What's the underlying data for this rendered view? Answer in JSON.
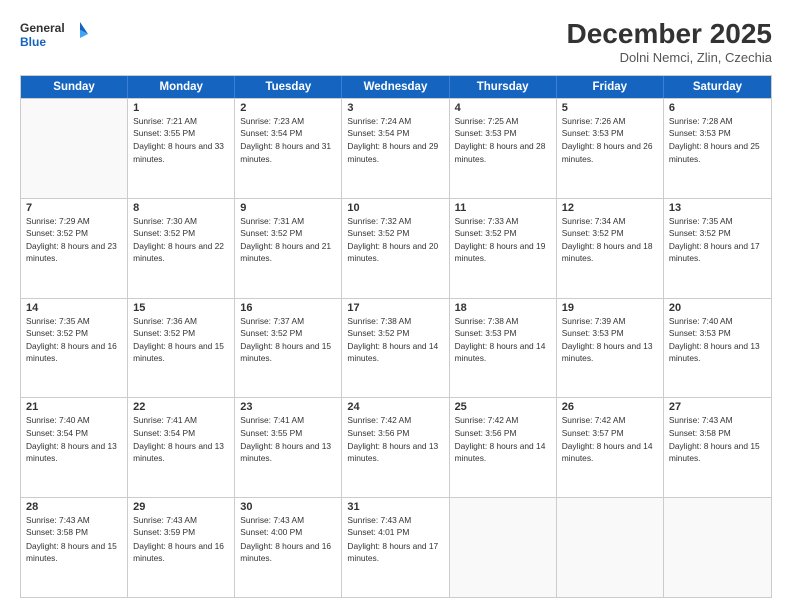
{
  "header": {
    "logo_line1": "General",
    "logo_line2": "Blue",
    "month": "December 2025",
    "location": "Dolni Nemci, Zlin, Czechia"
  },
  "days_of_week": [
    "Sunday",
    "Monday",
    "Tuesday",
    "Wednesday",
    "Thursday",
    "Friday",
    "Saturday"
  ],
  "weeks": [
    [
      {
        "day": "",
        "sunrise": "",
        "sunset": "",
        "daylight": ""
      },
      {
        "day": "1",
        "sunrise": "Sunrise: 7:21 AM",
        "sunset": "Sunset: 3:55 PM",
        "daylight": "Daylight: 8 hours and 33 minutes."
      },
      {
        "day": "2",
        "sunrise": "Sunrise: 7:23 AM",
        "sunset": "Sunset: 3:54 PM",
        "daylight": "Daylight: 8 hours and 31 minutes."
      },
      {
        "day": "3",
        "sunrise": "Sunrise: 7:24 AM",
        "sunset": "Sunset: 3:54 PM",
        "daylight": "Daylight: 8 hours and 29 minutes."
      },
      {
        "day": "4",
        "sunrise": "Sunrise: 7:25 AM",
        "sunset": "Sunset: 3:53 PM",
        "daylight": "Daylight: 8 hours and 28 minutes."
      },
      {
        "day": "5",
        "sunrise": "Sunrise: 7:26 AM",
        "sunset": "Sunset: 3:53 PM",
        "daylight": "Daylight: 8 hours and 26 minutes."
      },
      {
        "day": "6",
        "sunrise": "Sunrise: 7:28 AM",
        "sunset": "Sunset: 3:53 PM",
        "daylight": "Daylight: 8 hours and 25 minutes."
      }
    ],
    [
      {
        "day": "7",
        "sunrise": "Sunrise: 7:29 AM",
        "sunset": "Sunset: 3:52 PM",
        "daylight": "Daylight: 8 hours and 23 minutes."
      },
      {
        "day": "8",
        "sunrise": "Sunrise: 7:30 AM",
        "sunset": "Sunset: 3:52 PM",
        "daylight": "Daylight: 8 hours and 22 minutes."
      },
      {
        "day": "9",
        "sunrise": "Sunrise: 7:31 AM",
        "sunset": "Sunset: 3:52 PM",
        "daylight": "Daylight: 8 hours and 21 minutes."
      },
      {
        "day": "10",
        "sunrise": "Sunrise: 7:32 AM",
        "sunset": "Sunset: 3:52 PM",
        "daylight": "Daylight: 8 hours and 20 minutes."
      },
      {
        "day": "11",
        "sunrise": "Sunrise: 7:33 AM",
        "sunset": "Sunset: 3:52 PM",
        "daylight": "Daylight: 8 hours and 19 minutes."
      },
      {
        "day": "12",
        "sunrise": "Sunrise: 7:34 AM",
        "sunset": "Sunset: 3:52 PM",
        "daylight": "Daylight: 8 hours and 18 minutes."
      },
      {
        "day": "13",
        "sunrise": "Sunrise: 7:35 AM",
        "sunset": "Sunset: 3:52 PM",
        "daylight": "Daylight: 8 hours and 17 minutes."
      }
    ],
    [
      {
        "day": "14",
        "sunrise": "Sunrise: 7:35 AM",
        "sunset": "Sunset: 3:52 PM",
        "daylight": "Daylight: 8 hours and 16 minutes."
      },
      {
        "day": "15",
        "sunrise": "Sunrise: 7:36 AM",
        "sunset": "Sunset: 3:52 PM",
        "daylight": "Daylight: 8 hours and 15 minutes."
      },
      {
        "day": "16",
        "sunrise": "Sunrise: 7:37 AM",
        "sunset": "Sunset: 3:52 PM",
        "daylight": "Daylight: 8 hours and 15 minutes."
      },
      {
        "day": "17",
        "sunrise": "Sunrise: 7:38 AM",
        "sunset": "Sunset: 3:52 PM",
        "daylight": "Daylight: 8 hours and 14 minutes."
      },
      {
        "day": "18",
        "sunrise": "Sunrise: 7:38 AM",
        "sunset": "Sunset: 3:53 PM",
        "daylight": "Daylight: 8 hours and 14 minutes."
      },
      {
        "day": "19",
        "sunrise": "Sunrise: 7:39 AM",
        "sunset": "Sunset: 3:53 PM",
        "daylight": "Daylight: 8 hours and 13 minutes."
      },
      {
        "day": "20",
        "sunrise": "Sunrise: 7:40 AM",
        "sunset": "Sunset: 3:53 PM",
        "daylight": "Daylight: 8 hours and 13 minutes."
      }
    ],
    [
      {
        "day": "21",
        "sunrise": "Sunrise: 7:40 AM",
        "sunset": "Sunset: 3:54 PM",
        "daylight": "Daylight: 8 hours and 13 minutes."
      },
      {
        "day": "22",
        "sunrise": "Sunrise: 7:41 AM",
        "sunset": "Sunset: 3:54 PM",
        "daylight": "Daylight: 8 hours and 13 minutes."
      },
      {
        "day": "23",
        "sunrise": "Sunrise: 7:41 AM",
        "sunset": "Sunset: 3:55 PM",
        "daylight": "Daylight: 8 hours and 13 minutes."
      },
      {
        "day": "24",
        "sunrise": "Sunrise: 7:42 AM",
        "sunset": "Sunset: 3:56 PM",
        "daylight": "Daylight: 8 hours and 13 minutes."
      },
      {
        "day": "25",
        "sunrise": "Sunrise: 7:42 AM",
        "sunset": "Sunset: 3:56 PM",
        "daylight": "Daylight: 8 hours and 14 minutes."
      },
      {
        "day": "26",
        "sunrise": "Sunrise: 7:42 AM",
        "sunset": "Sunset: 3:57 PM",
        "daylight": "Daylight: 8 hours and 14 minutes."
      },
      {
        "day": "27",
        "sunrise": "Sunrise: 7:43 AM",
        "sunset": "Sunset: 3:58 PM",
        "daylight": "Daylight: 8 hours and 15 minutes."
      }
    ],
    [
      {
        "day": "28",
        "sunrise": "Sunrise: 7:43 AM",
        "sunset": "Sunset: 3:58 PM",
        "daylight": "Daylight: 8 hours and 15 minutes."
      },
      {
        "day": "29",
        "sunrise": "Sunrise: 7:43 AM",
        "sunset": "Sunset: 3:59 PM",
        "daylight": "Daylight: 8 hours and 16 minutes."
      },
      {
        "day": "30",
        "sunrise": "Sunrise: 7:43 AM",
        "sunset": "Sunset: 4:00 PM",
        "daylight": "Daylight: 8 hours and 16 minutes."
      },
      {
        "day": "31",
        "sunrise": "Sunrise: 7:43 AM",
        "sunset": "Sunset: 4:01 PM",
        "daylight": "Daylight: 8 hours and 17 minutes."
      },
      {
        "day": "",
        "sunrise": "",
        "sunset": "",
        "daylight": ""
      },
      {
        "day": "",
        "sunrise": "",
        "sunset": "",
        "daylight": ""
      },
      {
        "day": "",
        "sunrise": "",
        "sunset": "",
        "daylight": ""
      }
    ]
  ]
}
